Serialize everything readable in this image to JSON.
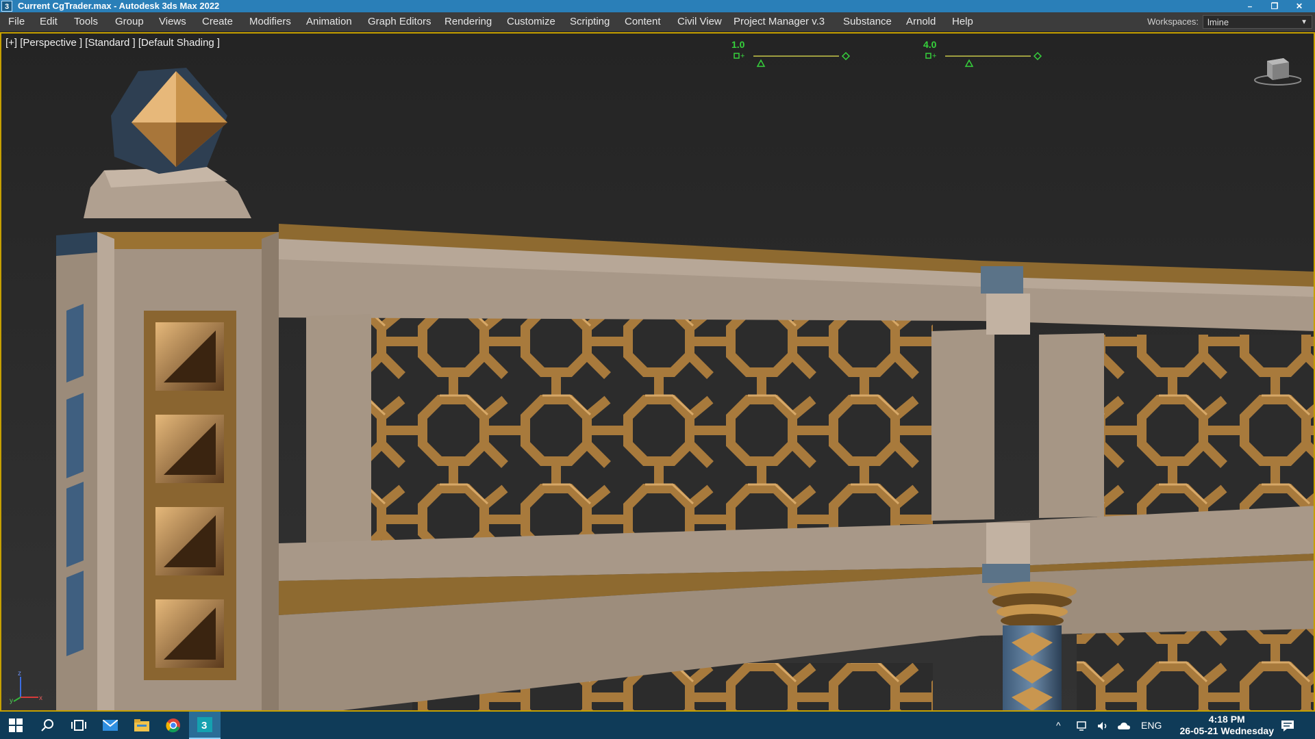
{
  "window": {
    "title": "Current CgTrader.max - Autodesk 3ds Max 2022",
    "app_icon": "3",
    "minimize_icon": "minimize-icon",
    "restore_icon": "restore-icon",
    "close_icon": "close-icon"
  },
  "menu": {
    "items": [
      "File",
      "Edit",
      "Tools",
      "Group",
      "Views",
      "Create",
      "Modifiers",
      "Animation",
      "Graph Editors",
      "Rendering",
      "Customize",
      "Scripting",
      "Content",
      "Civil View",
      "Project Manager v.3",
      "Substance",
      "Arnold",
      "Help"
    ],
    "workspaces_label": "Workspaces:",
    "workspace_value": "lmine"
  },
  "viewport": {
    "label": "[+] [Perspective ] [Standard ] [Default Shading ]",
    "gizmo_left_value": "1.0",
    "gizmo_right_value": "4.0",
    "colors": {
      "wood": "#9a7232",
      "stone": "#a29383",
      "gold": "#c8964e",
      "blue": "#30465c"
    }
  },
  "taskbar": {
    "language": "ENG",
    "time": "4:18 PM",
    "date": "26-05-21 Wednesday",
    "icons": [
      "windows-start-icon",
      "search-icon",
      "task-view-icon",
      "mail-icon",
      "file-explorer-icon",
      "chrome-icon",
      "3dsmax-icon"
    ]
  }
}
